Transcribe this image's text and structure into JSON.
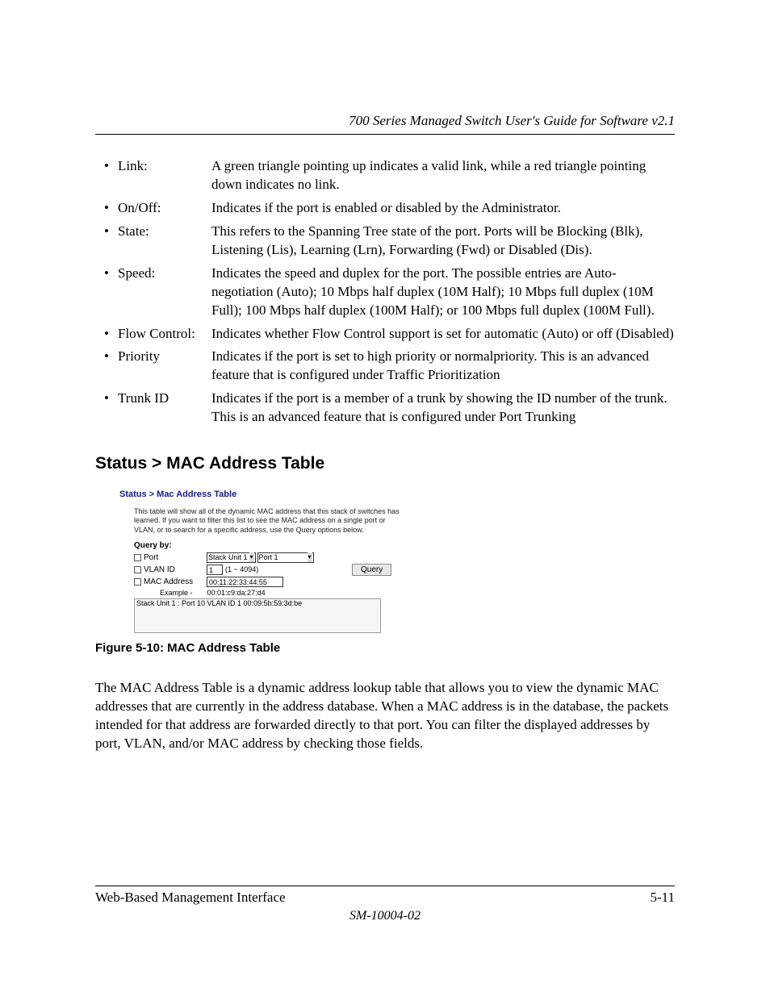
{
  "header": {
    "title": "700 Series Managed Switch User's Guide for Software v2.1"
  },
  "defs": [
    {
      "term": "Link:",
      "desc": "A green triangle pointing up indicates a valid link, while a red triangle pointing down indicates no link."
    },
    {
      "term": "On/Off:",
      "desc": "Indicates if the port is enabled or disabled by the Administrator."
    },
    {
      "term": "State:",
      "desc": "This refers to the Spanning Tree state of the port.  Ports will be Blocking (Blk), Listening (Lis), Learning (Lrn), Forwarding (Fwd) or Disabled (Dis)."
    },
    {
      "term": "Speed:",
      "desc": "Indicates the speed and duplex for the port.  The possible entries are Auto-negotiation (Auto); 10 Mbps half duplex (10M Half); 10 Mbps full duplex (10M Full); 100 Mbps half duplex (100M Half); or 100 Mbps full duplex (100M Full)."
    },
    {
      "term": "Flow Control:",
      "desc": "Indicates whether Flow Control support is set for automatic  (Auto) or off (Disabled)"
    },
    {
      "term": "Priority",
      "desc": "Indicates if the port is set to high priority or normalpriority.  This is an advanced feature that is configured under Traffic Prioritization"
    },
    {
      "term": "Trunk ID",
      "desc": "Indicates if the port is a member of a trunk by showing the ID number of the trunk.  This is an advanced feature that is configured under Port Trunking"
    }
  ],
  "section_heading": "Status > MAC Address Table",
  "figure": {
    "title": "Status > Mac Address Table",
    "instr": "This table will show all of the dynamic MAC address that this stack of switches has learned. If you want to filter this list to see the MAC address on a single port or VLAN, or to search for a specific address, use the Query options below.",
    "query_by": "Query by:",
    "rows": {
      "port": {
        "label": "Port",
        "sel1": "Stack Unit 1",
        "sel2": "Port 1"
      },
      "vlan": {
        "label": "VLAN ID",
        "value": "1",
        "range": "(1 ~ 4094)"
      },
      "mac": {
        "label": "MAC Address",
        "value": "00:11:22:33:44:55"
      }
    },
    "example_label": "Example -",
    "example_value": "00:01:c9:da:27:d4",
    "button": "Query",
    "result": "Stack Unit 1 : Port 10   VLAN ID 1   00:09:5b:59:3d:be"
  },
  "figure_caption": "Figure 5-10:  MAC Address Table",
  "body_para": "The MAC Address Table is a dynamic address lookup table that allows you to view the dynamic MAC addresses that are currently in the address database. When a MAC address is in the database, the packets intended for that address are forwarded directly to that port. You can filter the displayed addresses by port, VLAN, and/or MAC address by checking those fields.",
  "footer": {
    "left": "Web-Based Management Interface",
    "right": "5-11",
    "doc": "SM-10004-02"
  }
}
